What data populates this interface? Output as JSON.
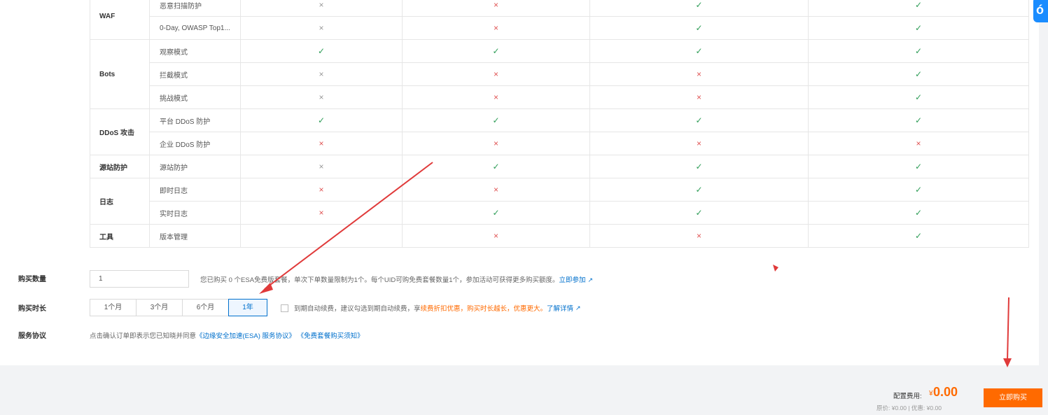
{
  "table": {
    "groups": [
      {
        "name": "WAF",
        "features": [
          {
            "name": "恶意扫描防护",
            "marks": [
              "no-grey",
              "no-red",
              "yes",
              "yes"
            ]
          },
          {
            "name": "0-Day, OWASP Top1...",
            "marks": [
              "no-grey",
              "no-red",
              "yes",
              "yes"
            ]
          }
        ]
      },
      {
        "name": "Bots",
        "features": [
          {
            "name": "观察模式",
            "marks": [
              "yes",
              "yes",
              "yes",
              "yes"
            ]
          },
          {
            "name": "拦截模式",
            "marks": [
              "no-grey",
              "no-red",
              "no-red",
              "yes"
            ]
          },
          {
            "name": "挑战模式",
            "marks": [
              "no-grey",
              "no-red",
              "no-red",
              "yes"
            ]
          }
        ]
      },
      {
        "name": "DDoS 攻击",
        "features": [
          {
            "name": "平台 DDoS 防护",
            "marks": [
              "yes",
              "yes",
              "yes",
              "yes"
            ]
          },
          {
            "name": "企业 DDoS 防护",
            "marks": [
              "no-red",
              "no-red",
              "no-red",
              "no-red"
            ]
          }
        ]
      },
      {
        "name": "源站防护",
        "features": [
          {
            "name": "源站防护",
            "marks": [
              "no-grey",
              "yes",
              "yes",
              "yes"
            ]
          }
        ]
      },
      {
        "name": "日志",
        "features": [
          {
            "name": "即时日志",
            "marks": [
              "no-red",
              "no-red",
              "yes",
              "yes"
            ]
          },
          {
            "name": "实时日志",
            "marks": [
              "no-red",
              "yes",
              "yes",
              "yes"
            ]
          }
        ]
      },
      {
        "name": "工具",
        "features": [
          {
            "name": "版本管理",
            "marks": [
              "none",
              "no-red",
              "no-red",
              "yes"
            ]
          }
        ]
      }
    ],
    "symbols": {
      "yes": "✓",
      "no": "×"
    },
    "colors": {
      "yes": "#2e9d57",
      "no_grey": "#999999",
      "no_red": "#e05454"
    }
  },
  "quantity": {
    "label": "购买数量",
    "value": "1",
    "note": "您已购买 0 个ESA免费版套餐，单次下单数量限制为1个。每个UID可购免费套餐数量1个，参加活动可获得更多购买额度。",
    "link": "立即参加"
  },
  "duration": {
    "label": "购买时长",
    "options": [
      "1个月",
      "3个月",
      "6个月",
      "1年"
    ],
    "selected": "1年",
    "auto_renew_prefix": "到期自动续费，建议勾选到期自动续费，享",
    "auto_renew_highlight": "续费折扣优惠，购买时长越长，优惠更大。",
    "auto_renew_link": "了解详情"
  },
  "agreement": {
    "label": "服务协议",
    "text": "点击确认订单即表示您已知晓并同意",
    "link1": "《边缘安全加速(ESA) 服务协议》",
    "link2": "《免费套餐购买须知》"
  },
  "footer": {
    "price_label": "配置费用:",
    "currency": "¥",
    "price": "0.00",
    "sub": "原价: ¥0.00 | 优惠: ¥0.00",
    "buy_label": "立即购买"
  },
  "badge": "ó",
  "colors": {
    "accent": "#ff6a00",
    "link": "#0070cc",
    "annotation": "#e03a3a"
  }
}
